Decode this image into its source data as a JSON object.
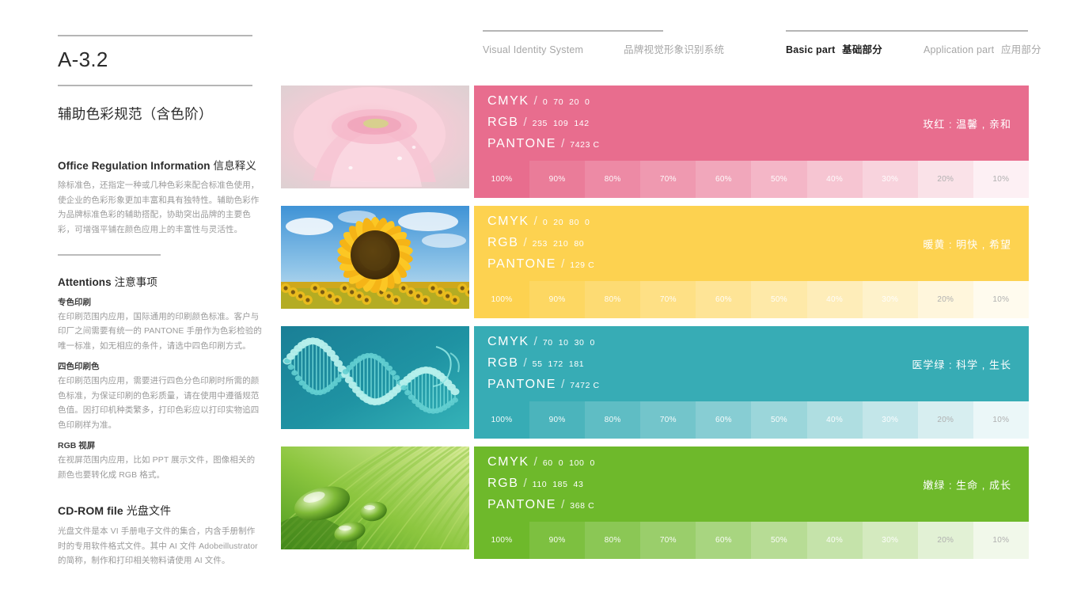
{
  "header": {
    "rule_left": true,
    "groups": [
      {
        "items": [
          {
            "en": "Visual Identity System",
            "cn": "",
            "active": false
          },
          {
            "en": "",
            "cn": "品牌视觉形象识别系统",
            "active": false
          }
        ]
      },
      {
        "items": [
          {
            "en": "Basic part",
            "cn": "基础部分",
            "active": true
          },
          {
            "en": "Application part",
            "cn": "应用部分",
            "active": false
          }
        ]
      }
    ],
    "visual_identity_system": "Visual Identity System",
    "visual_identity_system_cn": "品牌视觉形象识别系统",
    "basic_part": "Basic part",
    "basic_part_cn": "基础部分",
    "application_part": "Application part",
    "application_part_cn": "应用部分"
  },
  "sidebar": {
    "page_code": "A-3.2",
    "page_title": "辅助色彩规范（含色阶）",
    "sections": [
      {
        "heading_en": "Office Regulation Information",
        "heading_cn": "信息释义",
        "body": "除标准色，还指定一种或几种色彩来配合标准色使用，使企业的色彩形象更加丰富和具有独特性。辅助色彩作为品牌标准色彩的辅助搭配，协助突出品牌的主要色彩，可增强平铺在颜色应用上的丰富性与灵活性。"
      },
      {
        "heading_en": "Attentions",
        "heading_cn": "注意事项",
        "subsections": [
          {
            "title": "专色印刷",
            "body": "在印刷范围内应用，国际通用的印刷颜色标准。客户与印厂之间需要有统一的 PANTONE 手册作为色彩检验的唯一标准，如无相应的条件，请选中四色印刷方式。"
          },
          {
            "title": "四色印刷色",
            "body": "在印刷范围内应用，需要进行四色分色印刷时所需的颜色标准，为保证印刷的色彩质量，请在使用中遵循规范色值。因打印机种类繁多，打印色彩应以打印实物追四色印刷样为准。"
          },
          {
            "title": "RGB 视屏",
            "body": "在视屏范围内应用，比如 PPT 展示文件，图像相关的颜色也要转化成 RGB 格式。"
          }
        ]
      },
      {
        "heading_en": "CD-ROM file",
        "heading_cn": "光盘文件",
        "body": "光盘文件是本 VI 手册电子文件的集合，内含手册制作时的专用软件格式文件。其中 AI 文件 Adobeillustrator 的简称，制作和打印相关物料请使用 AI 文件。"
      }
    ]
  },
  "palette": {
    "labels": {
      "cmyk": "CMYK",
      "rgb": "RGB",
      "pantone": "PANTONE",
      "slash": "/"
    },
    "tint_steps": [
      "100%",
      "90%",
      "80%",
      "70%",
      "60%",
      "50%",
      "40%",
      "30%",
      "20%",
      "10%"
    ],
    "swatches": [
      {
        "name": "玫红",
        "meaning": "玫红 : 温馨 , 亲和",
        "hex": "#e86d8e",
        "cmyk": [
          "0",
          "70",
          "20",
          "0"
        ],
        "rgb": [
          "235",
          "109",
          "142"
        ],
        "pantone": "7423 C",
        "image": "pink-rose-photo"
      },
      {
        "name": "暖黄",
        "meaning": "暖黄 : 明快 , 希望",
        "hex": "#fdd250",
        "cmyk": [
          "0",
          "20",
          "80",
          "0"
        ],
        "rgb": [
          "253",
          "210",
          "80"
        ],
        "pantone": "129 C",
        "image": "sunflower-photo"
      },
      {
        "name": "医学绿",
        "meaning": "医学绿 : 科学 , 生长",
        "hex": "#37acb5",
        "cmyk": [
          "70",
          "10",
          "30",
          "0"
        ],
        "rgb": [
          "55",
          "172",
          "181"
        ],
        "pantone": "7472 C",
        "image": "dna-helix-photo"
      },
      {
        "name": "嫩绿",
        "meaning": "嫩绿 : 生命 , 成长",
        "hex": "#6eb92b",
        "cmyk": [
          "60",
          "0",
          "100",
          "0"
        ],
        "rgb": [
          "110",
          "185",
          "43"
        ],
        "pantone": "368 C",
        "image": "green-leaf-dew-photo"
      }
    ]
  }
}
